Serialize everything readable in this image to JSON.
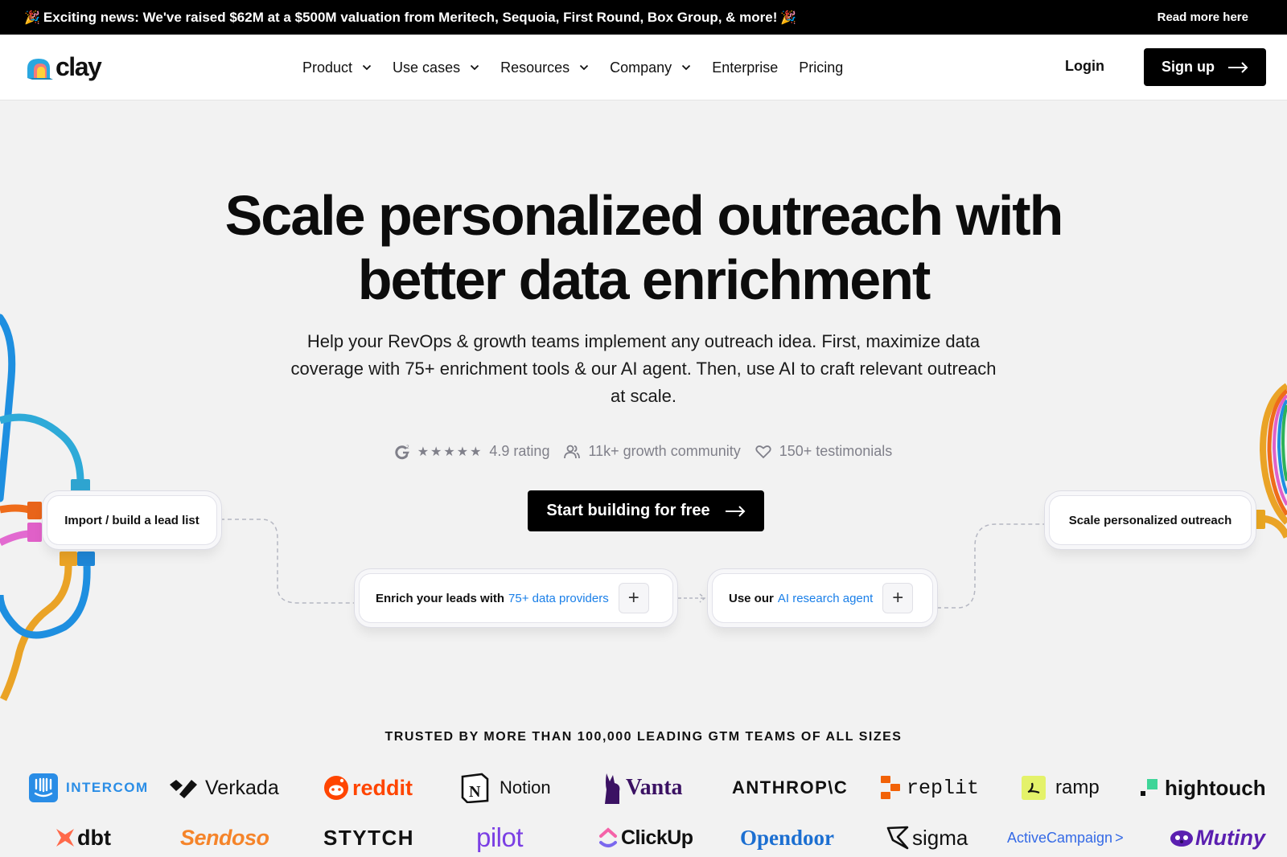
{
  "announcement": {
    "emoji": "🎉",
    "message": "Exciting news: We've raised $62M at a $500M valuation from Meritech, Sequoia, First Round, Box Group, & more!",
    "link": "Read more here"
  },
  "nav": {
    "brand": "clay",
    "menu": [
      {
        "label": "Product",
        "dropdown": true
      },
      {
        "label": "Use cases",
        "dropdown": true
      },
      {
        "label": "Resources",
        "dropdown": true
      },
      {
        "label": "Company",
        "dropdown": true
      },
      {
        "label": "Enterprise",
        "dropdown": false
      },
      {
        "label": "Pricing",
        "dropdown": false
      }
    ],
    "login": "Login",
    "signup": "Sign up"
  },
  "hero": {
    "title_line1": "Scale personalized outreach with",
    "title_line2": "better data enrichment",
    "subtitle": "Help your RevOps & growth teams implement any outreach idea. First, maximize data coverage with 75+ enrichment tools & our AI agent. Then, use AI to craft relevant outreach at scale.",
    "stats": {
      "rating_stars": 5,
      "rating": "4.9 rating",
      "community": "11k+ growth community",
      "testimonials": "150+ testimonials"
    },
    "cta": "Start building for free"
  },
  "flow": {
    "step1": "Import / build a lead list",
    "step2_prefix": "Enrich your leads with",
    "step2_link": "75+ data providers",
    "step3_prefix": "Use our",
    "step3_link": "AI research agent",
    "step4": "Scale personalized outreach",
    "plus": "+"
  },
  "trusted": {
    "heading": "TRUSTED BY MORE THAN 100,000 LEADING GTM TEAMS OF ALL SIZES",
    "row1": [
      "INTERCOM",
      "Verkada",
      "reddit",
      "Notion",
      "Vanta",
      "ANTHROP\\C",
      "replit",
      "ramp",
      "hightouch"
    ],
    "row2": [
      "dbt",
      "Sendoso",
      "STYTCH",
      "pilot",
      "ClickUp",
      "Opendoor",
      "sigma",
      "ActiveCampaign",
      "Mutiny"
    ]
  },
  "colors": {
    "link_blue": "#1a7fe8",
    "intercom": "#2a8de6",
    "reddit": "#ff4500",
    "vanta": "#3b1263",
    "replit": "#f26207",
    "ramp": "#e4f26a",
    "hightouch": "#3ed598",
    "dbt": "#ff694a",
    "sendoso": "#f5842a",
    "pilot": "#7b3fe4",
    "opendoor": "#1c6fd1",
    "activecampaign": "#356ae6",
    "mutiny": "#5b1fb0"
  }
}
